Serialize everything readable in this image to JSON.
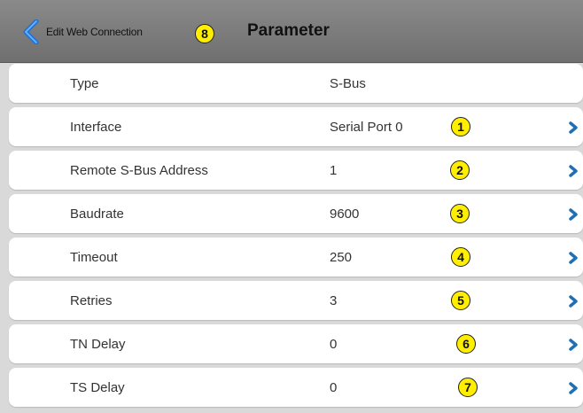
{
  "header": {
    "back_label": "Edit Web Connection",
    "back_badge": "8",
    "title": "Parameter"
  },
  "rows": [
    {
      "label": "Type",
      "value": "S-Bus"
    },
    {
      "label": "Interface",
      "value": "Serial Port 0",
      "badge": "1"
    },
    {
      "label": "Remote S-Bus Address",
      "value": "1",
      "badge": "2"
    },
    {
      "label": "Baudrate",
      "value": "9600",
      "badge": "3"
    },
    {
      "label": "Timeout",
      "value": "250",
      "badge": "4"
    },
    {
      "label": "Retries",
      "value": "3",
      "badge": "5"
    },
    {
      "label": "TN Delay",
      "value": "0",
      "badge": "6"
    },
    {
      "label": "TS Delay",
      "value": "0",
      "badge": "7"
    }
  ],
  "colors": {
    "badge_fill": "#ffee00",
    "chevron": "#1f6fb5",
    "header": "#7d7d7d"
  },
  "icons": {
    "back": "chevron-left-icon",
    "row": "chevron-right-icon"
  }
}
